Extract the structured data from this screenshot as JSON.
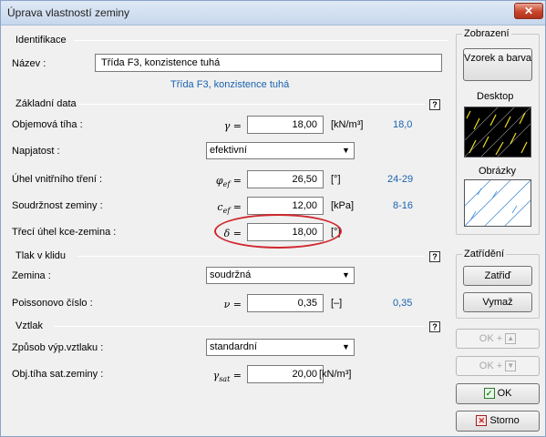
{
  "window": {
    "title": "Úprava vlastností zeminy",
    "close_glyph": "✕"
  },
  "identification": {
    "header": "Identifikace",
    "name_label": "Název :",
    "name_value": "Třída F3, konzistence tuhá",
    "name_display": "Třída F3, konzistence tuhá"
  },
  "basic": {
    "header": "Základní data",
    "help": "?",
    "unit_weight": {
      "label": "Objemová tíha :",
      "symbol": "γ =",
      "value": "18,00",
      "unit": "[kN/m³]",
      "hint": "18,0"
    },
    "stress": {
      "label": "Napjatost :",
      "value": "efektivní"
    },
    "friction": {
      "label": "Úhel vnitřního tření :",
      "symbol": "φ",
      "sub": "ef",
      "eq": "=",
      "value": "26,50",
      "unit": "[°]",
      "hint": "24-29"
    },
    "cohesion": {
      "label": "Soudržnost zeminy :",
      "symbol": "c",
      "sub": "ef",
      "eq": "=",
      "value": "12,00",
      "unit": "[kPa]",
      "hint": "8-16"
    },
    "structure_friction": {
      "label": "Třecí úhel kce-zemina :",
      "symbol": "δ =",
      "value": "18,00",
      "unit": "[°]"
    }
  },
  "rest": {
    "header": "Tlak v klidu",
    "help": "?",
    "soil": {
      "label": "Zemina :",
      "value": "soudržná"
    },
    "poisson": {
      "label": "Poissonovo číslo :",
      "symbol": "ν =",
      "value": "0,35",
      "unit": "[–]",
      "hint": "0,35"
    }
  },
  "uplift": {
    "header": "Vztlak",
    "help": "?",
    "method": {
      "label": "Způsob výp.vztlaku :",
      "value": "standardní"
    },
    "sat_weight": {
      "label": "Obj.tíha sat.zeminy :",
      "symbol": "γ",
      "sub": "sat",
      "eq": "=",
      "value": "20,00",
      "unit": "[kN/m³]"
    }
  },
  "display": {
    "header": "Zobrazení",
    "pattern_button": "Vzorek a barva",
    "desktop_label": "Desktop",
    "pictures_label": "Obrázky"
  },
  "classification": {
    "header": "Zatřídění",
    "classify_button": "Zatřiď",
    "clear_button": "Vymaž"
  },
  "buttons": {
    "ok_plus_up": "OK +",
    "ok_plus_down": "OK +",
    "ok": "OK",
    "cancel": "Storno"
  },
  "colors": {
    "highlight": "#d0262d",
    "hint_blue": "#1a62b0"
  }
}
